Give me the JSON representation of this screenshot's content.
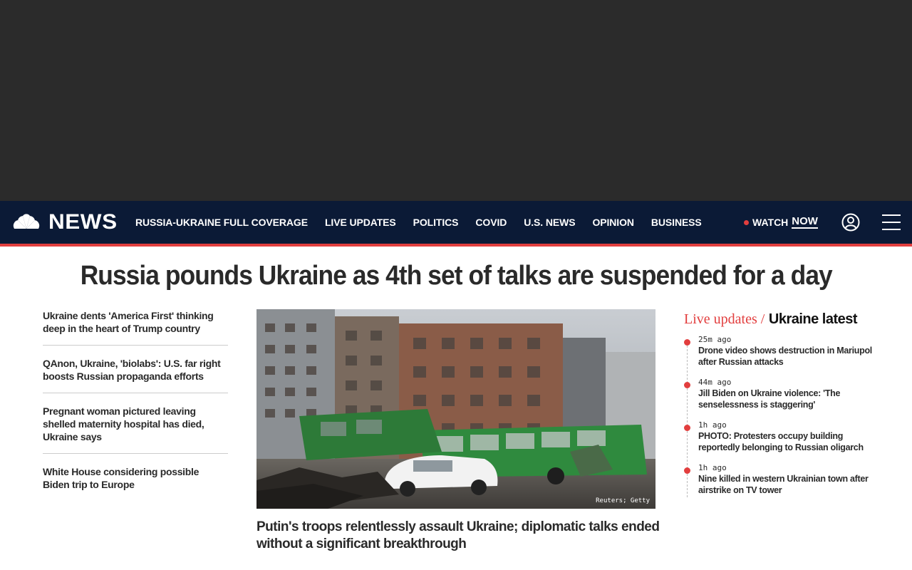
{
  "nav": {
    "logo_text": "NEWS",
    "links": [
      "RUSSIA-UKRAINE FULL COVERAGE",
      "LIVE UPDATES",
      "POLITICS",
      "COVID",
      "U.S. NEWS",
      "OPINION",
      "BUSINESS"
    ],
    "watch_label": "WATCH",
    "watch_now": "NOW"
  },
  "headline": "Russia pounds Ukraine as 4th set of talks are suspended for a day",
  "left_stories": [
    "Ukraine dents 'America First' thinking deep in the heart of Trump country",
    "QAnon, Ukraine, 'biolabs': U.S. far right boosts Russian propaganda efforts",
    "Pregnant woman pictured leaving shelled maternity hospital has died, Ukraine says",
    "White House considering possible Biden trip to Europe"
  ],
  "hero": {
    "credit": "Reuters; Getty",
    "caption": "Putin's troops relentlessly assault Ukraine; diplomatic talks ended without a significant breakthrough"
  },
  "live": {
    "label": "Live updates /",
    "topic": "Ukraine latest",
    "items": [
      {
        "time": "25m ago",
        "title": "Drone video shows destruction in Mariupol after Russian attacks"
      },
      {
        "time": "44m ago",
        "title": "Jill Biden on Ukraine violence: 'The senselessness is staggering'"
      },
      {
        "time": "1h ago",
        "title": "PHOTO: Protesters occupy building reportedly belonging to Russian oligarch"
      },
      {
        "time": "1h ago",
        "title": "Nine killed in western Ukrainian town after airstrike on TV tower"
      }
    ]
  },
  "colors": {
    "nav_bg": "#0b1a36",
    "accent_red": "#e23e3e",
    "ad_bg": "#2b2b2b"
  }
}
